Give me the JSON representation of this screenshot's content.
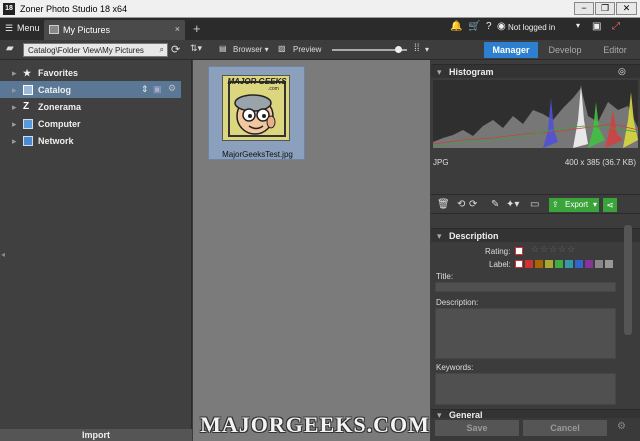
{
  "titlebar": {
    "app_icon": "18",
    "title": "Zoner Photo Studio 18 x64",
    "minimize": "−",
    "restore": "❐",
    "close": "✕"
  },
  "tabbar": {
    "menu_label": "Menu",
    "tab_label": "My Pictures",
    "tab_close": "×",
    "add_tab": "+",
    "user_status": "Not logged in"
  },
  "toolbar": {
    "path": "Catalog\\Folder View\\My Pictures",
    "browser_label": "Browser",
    "preview_label": "Preview",
    "zoom_level": 0.88,
    "modes": [
      "Manager",
      "Develop",
      "Editor"
    ]
  },
  "navigator": {
    "items": [
      {
        "label": "Favorites",
        "icon": "star-icon"
      },
      {
        "label": "Catalog",
        "icon": "catalog-icon"
      },
      {
        "label": "Zonerama",
        "icon": "zonerama-icon"
      },
      {
        "label": "Computer",
        "icon": "computer-icon"
      },
      {
        "label": "Network",
        "icon": "network-icon"
      }
    ],
    "import_label": "Import"
  },
  "browser": {
    "thumb_title": "MAJOR GEEKS",
    "thumb_subtitle": ".com",
    "file_name": "MajorGeeksTest.jpg"
  },
  "histogram": {
    "title": "Histogram",
    "format": "JPG",
    "info": "400 x 385 (36.7 KB)"
  },
  "actions": {
    "export_label": "Export"
  },
  "description": {
    "title": "Description",
    "rating_label": "Rating:",
    "label_label": "Label:",
    "title_field": "Title:",
    "description_field": "Description:",
    "keywords_field": "Keywords:",
    "general_label": "General",
    "label_colors": [
      "#c33",
      "#a60",
      "#aa3",
      "#4a4",
      "#39a",
      "#36c",
      "#839",
      "#888",
      "#999"
    ]
  },
  "footer": {
    "save_label": "Save",
    "cancel_label": "Cancel"
  },
  "watermark": "MAJORGEEKS.COM"
}
